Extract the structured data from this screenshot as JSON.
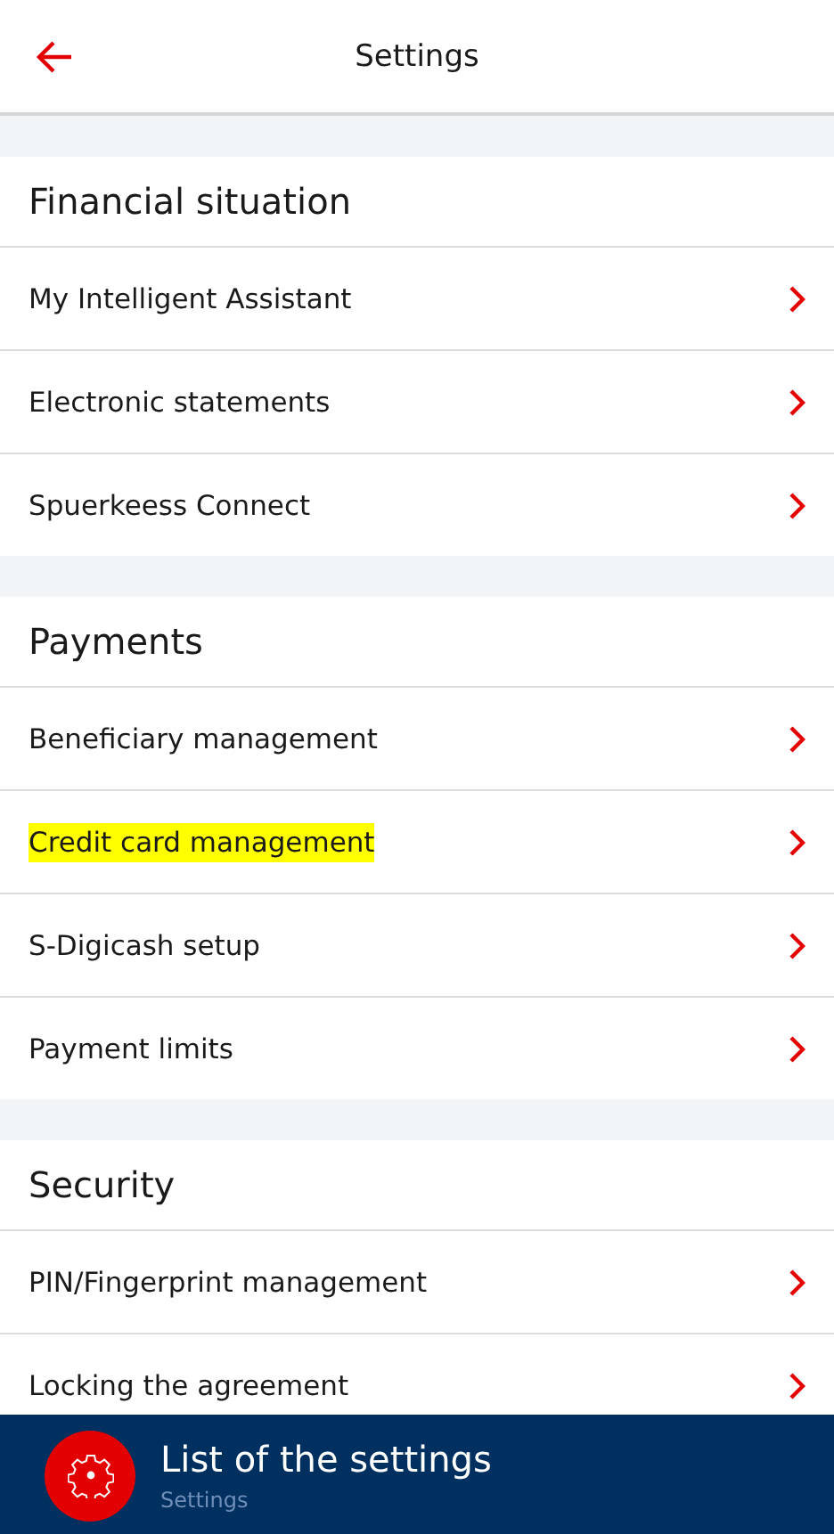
{
  "header": {
    "title": "Settings"
  },
  "sections": [
    {
      "title": "Financial situation",
      "items": [
        {
          "label": "My Intelligent Assistant",
          "highlighted": false
        },
        {
          "label": "Electronic statements",
          "highlighted": false
        },
        {
          "label": "Spuerkeess Connect",
          "highlighted": false
        }
      ]
    },
    {
      "title": "Payments",
      "items": [
        {
          "label": "Beneficiary management",
          "highlighted": false
        },
        {
          "label": "Credit card management",
          "highlighted": true
        },
        {
          "label": "S-Digicash setup",
          "highlighted": false
        },
        {
          "label": "Payment limits",
          "highlighted": false
        }
      ]
    },
    {
      "title": "Security",
      "items": [
        {
          "label": "PIN/Fingerprint management",
          "highlighted": false
        },
        {
          "label": "Locking the agreement",
          "highlighted": false
        }
      ]
    }
  ],
  "bottom_bar": {
    "title": "List of the settings",
    "subtitle": "Settings"
  }
}
